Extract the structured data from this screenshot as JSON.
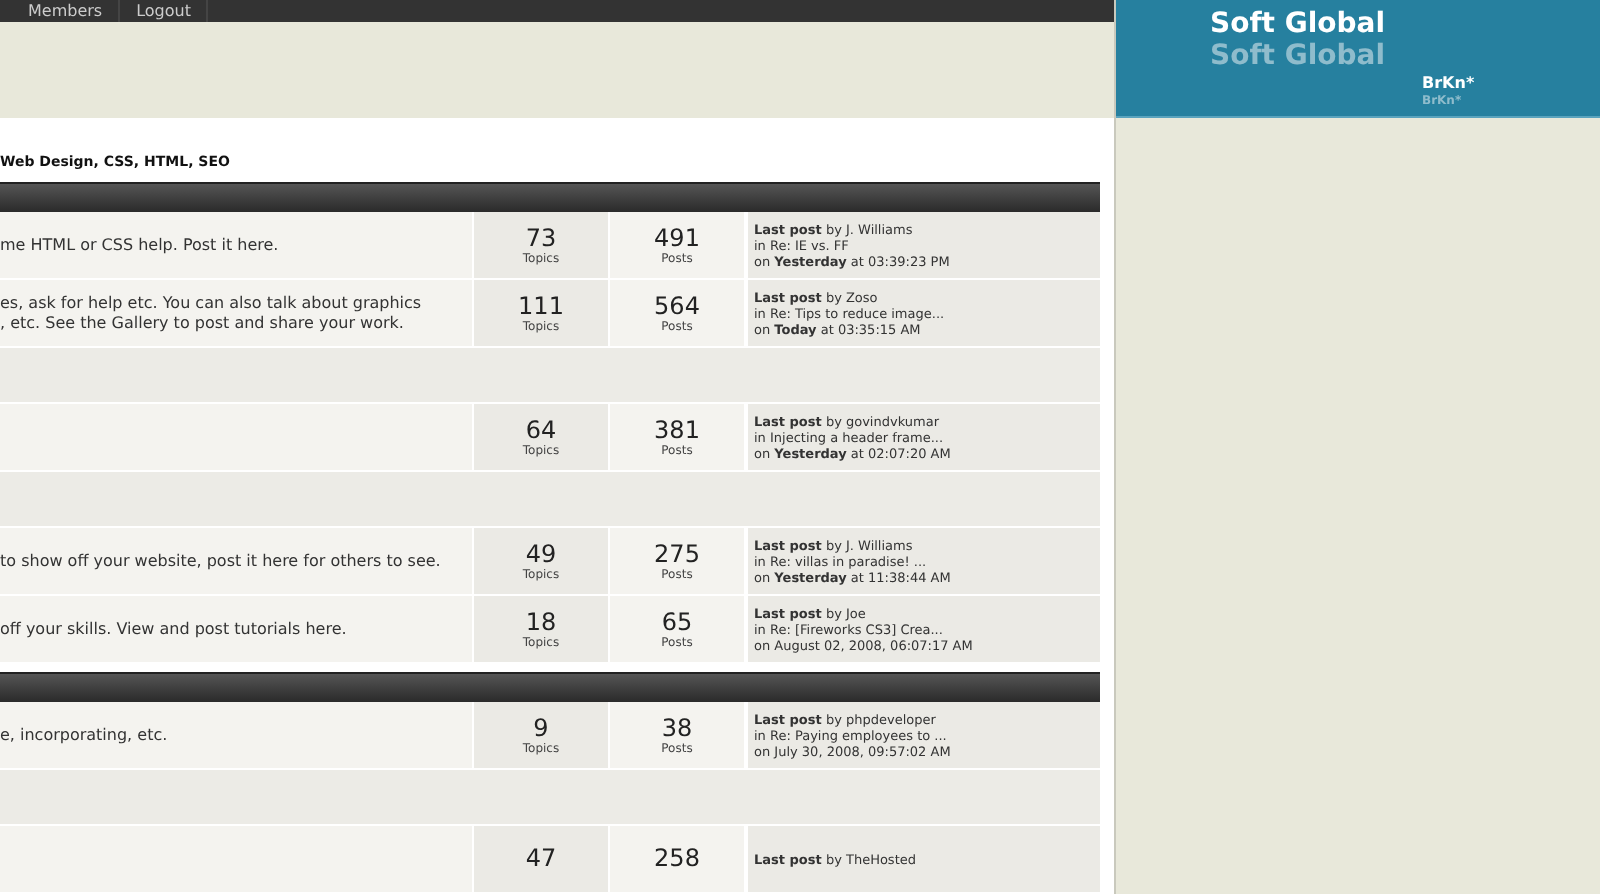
{
  "nav": {
    "items": [
      "Members",
      "Logout"
    ]
  },
  "breadcrumb": "Web Design, CSS, HTML, SEO",
  "sections": [
    {
      "rows": [
        {
          "kind": "forum",
          "description": [
            "me HTML or CSS help. Post it here."
          ],
          "topics": "73",
          "topics_label": "Topics",
          "posts": "491",
          "posts_label": "Posts",
          "last_post": [
            "**Last post** by J. Williams",
            "in Re: IE vs. FF",
            "on **Yesterday** at 03:39:23 PM"
          ]
        },
        {
          "kind": "forum",
          "description": [
            "es, ask for help etc. You can also talk about graphics",
            ", etc. See the Gallery to post and share your work."
          ],
          "topics": "111",
          "topics_label": "Topics",
          "posts": "564",
          "posts_label": "Posts",
          "last_post": [
            "**Last post** by Zoso",
            "in Re: Tips to reduce image...",
            "on **Today** at 03:35:15 AM"
          ]
        },
        {
          "kind": "spacer"
        },
        {
          "kind": "forum",
          "description": [],
          "topics": "64",
          "topics_label": "Topics",
          "posts": "381",
          "posts_label": "Posts",
          "last_post": [
            "**Last post** by govindvkumar",
            "in Injecting a header frame...",
            "on **Yesterday** at 02:07:20 AM"
          ]
        },
        {
          "kind": "spacer"
        },
        {
          "kind": "forum",
          "description": [
            "to show off your website, post it here for others to see."
          ],
          "topics": "49",
          "topics_label": "Topics",
          "posts": "275",
          "posts_label": "Posts",
          "last_post": [
            "**Last post** by J. Williams",
            "in Re: villas in paradise! ...",
            "on **Yesterday** at 11:38:44 AM"
          ]
        },
        {
          "kind": "forum",
          "description": [
            "off your skills. View and post tutorials here."
          ],
          "topics": "18",
          "topics_label": "Topics",
          "posts": "65",
          "posts_label": "Posts",
          "last_post": [
            "**Last post** by Joe",
            "in Re: [Fireworks CS3] Crea...",
            "on August 02, 2008, 06:07:17 AM"
          ]
        }
      ]
    },
    {
      "rows": [
        {
          "kind": "forum",
          "description": [
            "e, incorporating, etc."
          ],
          "topics": "9",
          "topics_label": "Topics",
          "posts": "38",
          "posts_label": "Posts",
          "last_post": [
            "**Last post** by phpdeveloper",
            "in Re: Paying employees to ...",
            "on July 30, 2008, 09:57:02 AM"
          ]
        },
        {
          "kind": "spacer"
        },
        {
          "kind": "forum",
          "description": [],
          "topics": "47",
          "posts": "258",
          "last_post": [
            "**Last post** by TheHosted"
          ]
        }
      ]
    }
  ],
  "logo": {
    "title": "Soft Global",
    "reflection": "Soft Global",
    "badge": "BrKn*",
    "badge_reflection": "BrKn*"
  }
}
